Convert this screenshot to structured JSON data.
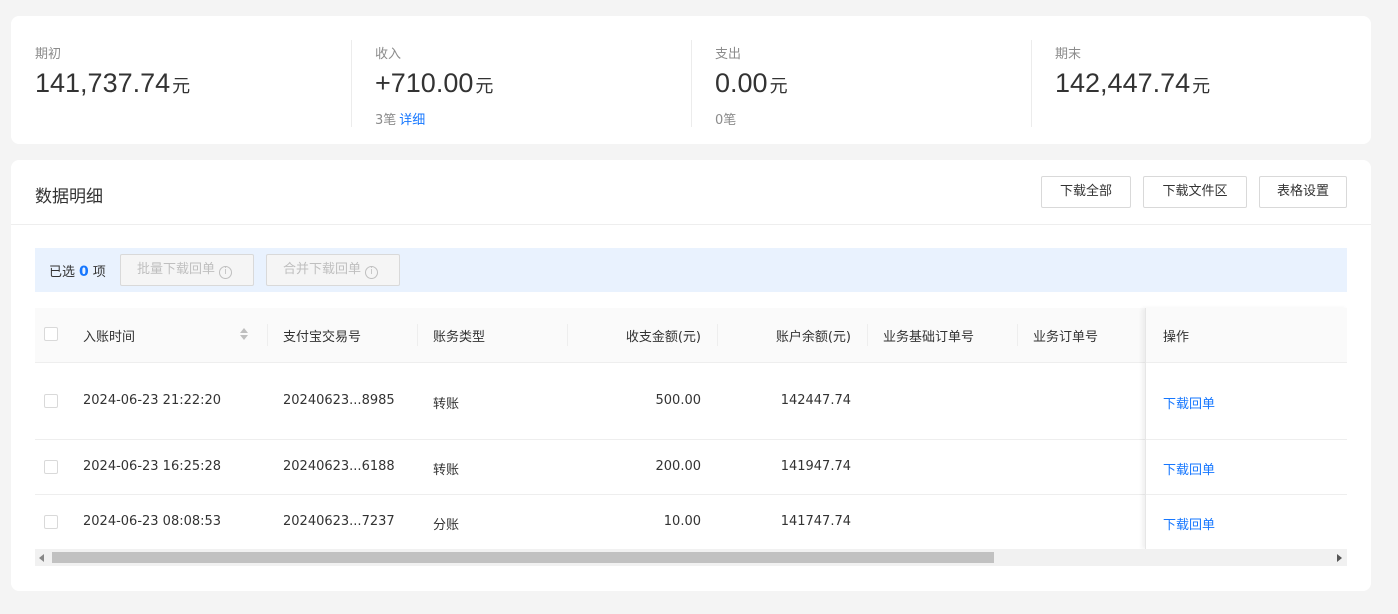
{
  "summary": {
    "items": [
      {
        "label": "期初",
        "amount": "141,737.74",
        "unit": "元",
        "sub_count": "",
        "sub_link": ""
      },
      {
        "label": "收入",
        "amount": "+710.00",
        "unit": "元",
        "sub_count": "3笔",
        "sub_link": "详细"
      },
      {
        "label": "支出",
        "amount": "0.00",
        "unit": "元",
        "sub_count": "0笔",
        "sub_link": ""
      },
      {
        "label": "期末",
        "amount": "142,447.74",
        "unit": "元",
        "sub_count": "",
        "sub_link": ""
      }
    ]
  },
  "details": {
    "title": "数据明细",
    "buttons": {
      "download_all": "下载全部",
      "download_files": "下载文件区",
      "table_settings": "表格设置"
    },
    "selection": {
      "prefix": "已选",
      "count": "0",
      "suffix": "项",
      "batch_download": "批量下载回单",
      "merge_download": "合并下载回单",
      "info_icon": "i"
    },
    "columns": [
      "入账时间",
      "支付宝交易号",
      "账务类型",
      "收支金额(元)",
      "账户余额(元)",
      "业务基础订单号",
      "业务订单号",
      "操作"
    ],
    "rows": [
      {
        "time": "2024-06-23 21:22:20",
        "trade_no": "20240623...8985",
        "type": "转账",
        "amount": "500.00",
        "balance": "142447.74",
        "base_order": "",
        "order": "",
        "action": "下载回单"
      },
      {
        "time": "2024-06-23 16:25:28",
        "trade_no": "20240623...6188",
        "type": "转账",
        "amount": "200.00",
        "balance": "141947.74",
        "base_order": "",
        "order": "",
        "action": "下载回单"
      },
      {
        "time": "2024-06-23 08:08:53",
        "trade_no": "20240623...7237",
        "type": "分账",
        "amount": "10.00",
        "balance": "141747.74",
        "base_order": "",
        "order": "",
        "action": "下载回单"
      }
    ]
  },
  "colors": {
    "accent": "#1677ff",
    "background": "#f4f4f4",
    "selection_bar": "#e9f2fe"
  },
  "icons": [
    "info-icon",
    "sort-icon",
    "checkbox-icon",
    "scroll-left-arrow-icon",
    "scroll-right-arrow-icon"
  ]
}
